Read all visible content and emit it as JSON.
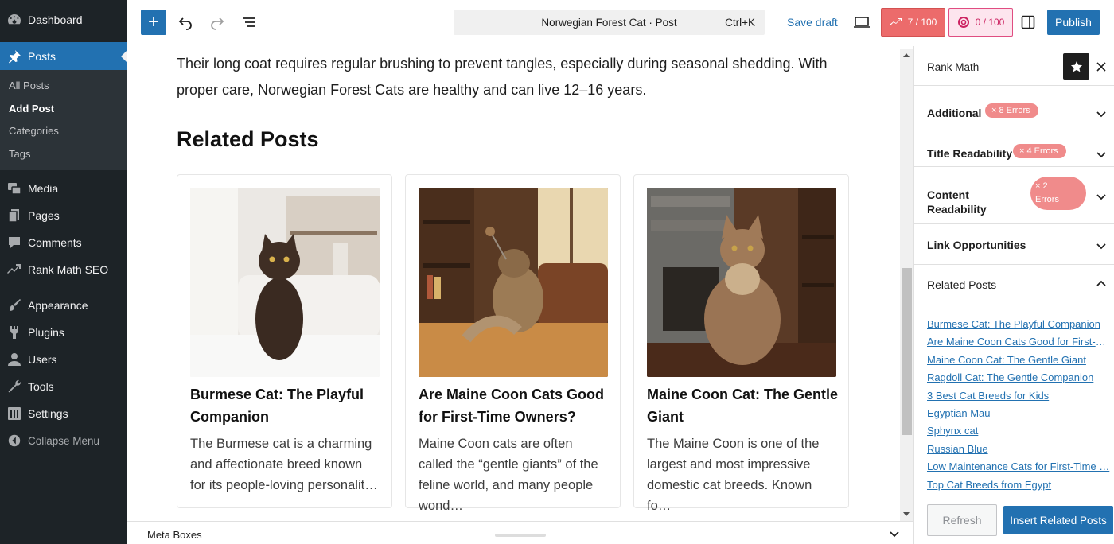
{
  "sidebar": {
    "dashboard": "Dashboard",
    "posts": "Posts",
    "sub": [
      "All Posts",
      "Add Post",
      "Categories",
      "Tags"
    ],
    "media": "Media",
    "pages": "Pages",
    "comments": "Comments",
    "rankmath": "Rank Math SEO",
    "appearance": "Appearance",
    "plugins": "Plugins",
    "users": "Users",
    "tools": "Tools",
    "settings": "Settings",
    "collapse": "Collapse Menu"
  },
  "toolbar": {
    "doc_title": "Norwegian Forest Cat · Post",
    "shortcut": "Ctrl+K",
    "save_draft": "Save draft",
    "seo_score": "7 / 100",
    "readability_score": "0 / 100",
    "publish": "Publish"
  },
  "content": {
    "paragraph": "Their long coat requires regular brushing to prevent tangles, especially during seasonal shedding. With proper care, Norwegian Forest Cats are healthy and can live 12–16 years.",
    "related_heading": "Related Posts",
    "cards": [
      {
        "title": "Burmese Cat: The Playful Companion",
        "excerpt": "The Burmese cat is a charming and affectionate breed known for its people-loving personalit…"
      },
      {
        "title": "Are Maine Coon Cats Good for First-Time Owners?",
        "excerpt": "Maine Coon cats are often called the “gentle giants” of the feline world, and many people wond…"
      },
      {
        "title": "Maine Coon Cat: The Gentle Giant",
        "excerpt": "The Maine Coon is one of the largest and most impressive domestic cat breeds. Known fo…"
      }
    ]
  },
  "meta": {
    "label": "Meta Boxes"
  },
  "panel": {
    "title": "Rank Math",
    "sections": {
      "additional": {
        "label": "Additional",
        "badge": "8 Errors"
      },
      "title_readability": {
        "label": "Title Readability",
        "badge": "4 Errors"
      },
      "content_readability": {
        "label_1": "Content",
        "label_2": "Readability",
        "badge_1": "2",
        "badge_2": "Errors"
      },
      "link_opportunities": {
        "label": "Link Opportunities"
      },
      "related_posts": {
        "label": "Related Posts"
      }
    },
    "related_links": [
      "Burmese Cat: The Playful Companion",
      "Are Maine Coon Cats Good for First-Ti…",
      "Maine Coon Cat: The Gentle Giant",
      "Ragdoll Cat: The Gentle Companion",
      "3 Best Cat Breeds for Kids",
      "Egyptian Mau",
      "Sphynx cat",
      "Russian Blue",
      "Low Maintenance Cats for First-Time …",
      "Top Cat Breeds from Egypt"
    ],
    "refresh": "Refresh",
    "insert": "Insert Related Posts"
  },
  "colors": {
    "accent": "#2271b1",
    "sidebar_bg": "#1d2327",
    "error_badge": "#f08b8b",
    "seo_score_bg": "#ec6b6b",
    "readability_score_border": "#e04d81"
  }
}
